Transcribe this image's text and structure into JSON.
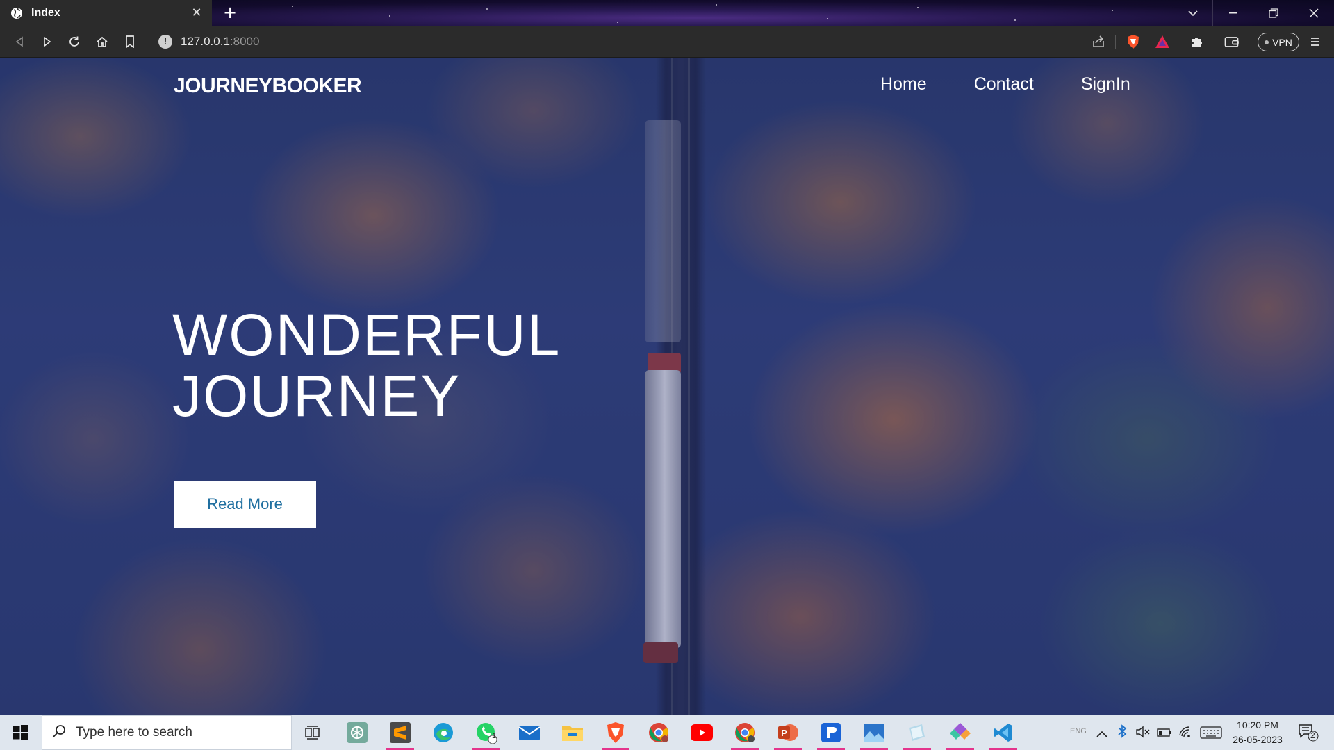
{
  "browser": {
    "tab_title": "Index",
    "new_tab_symbol": "+",
    "url_host": "127.0.0.1",
    "url_port": ":8000",
    "vpn_label": "VPN"
  },
  "site": {
    "logo": "JOURNEYBOOKER",
    "nav": [
      "Home",
      "Contact",
      "SignIn"
    ],
    "hero_line1": "WONDERFUL",
    "hero_line2": "JOURNEY",
    "cta_label": "Read More"
  },
  "taskbar": {
    "search_placeholder": "Type here to search",
    "whatsapp_badge": "1",
    "lang": "ENG",
    "time": "10:20 PM",
    "date": "26-05-2023",
    "notification_count": "2",
    "apps": [
      "task-view",
      "chatgpt",
      "sublime-text",
      "edge",
      "whatsapp",
      "mail",
      "file-explorer",
      "brave",
      "chrome-profile",
      "youtube",
      "chrome",
      "powerpoint",
      "word-notes",
      "photos",
      "notepad",
      "kite",
      "vscode"
    ]
  },
  "colors": {
    "tab_bg": "#2b2b2b",
    "cta_text": "#1f6fa0",
    "taskbar_bg": "#dfe6ee",
    "brave_orange": "#fb542b"
  }
}
